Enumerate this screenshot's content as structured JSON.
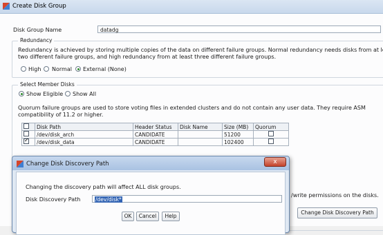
{
  "window": {
    "title": "Create Disk Group"
  },
  "disk_group": {
    "label": "Disk Group Name",
    "value": "datadg"
  },
  "redundancy": {
    "group_title": "Redundancy",
    "description_line1": "Redundancy is achieved by storing multiple copies of the data on different failure groups. Normal redundancy needs disks from at least",
    "description_line2": "two different failure groups, and high redundancy from at least three different failure groups.",
    "options": [
      "High",
      "Normal",
      "External (None)"
    ],
    "selected": "External (None)"
  },
  "member_disks": {
    "group_title": "Select Member Disks",
    "filters": [
      "Show Eligible",
      "Show All"
    ],
    "selected_filter": "Show Eligible",
    "quorum_note_line1": "Quorum failure groups are used to store voting files in extended clusters and do not contain any user data. They require ASM",
    "quorum_note_line2": "compatibility of 11.2 or higher.",
    "columns": [
      "Disk Path",
      "Header Status",
      "Disk Name",
      "Size (MB)",
      "Quorum"
    ],
    "rows": [
      {
        "path": "/dev/disk_arch",
        "status": "CANDIDATE",
        "name": "",
        "size": "51200",
        "selected": false,
        "quorum": false
      },
      {
        "path": "/dev/disk_data",
        "status": "CANDIDATE",
        "name": "",
        "size": "102400",
        "selected": true,
        "quorum": false
      }
    ],
    "permission_note": "/write permissions on the disks.",
    "change_path_button": "Change Disk Discovery Path"
  },
  "dialog": {
    "title": "Change Disk Discovery Path",
    "close_label": "x",
    "message": "Changing the discovery path will affect ALL disk groups.",
    "path_label": "Disk Discovery Path",
    "path_value": "/dev/disk*",
    "buttons": {
      "ok": "OK",
      "cancel": "Cancel",
      "help": "Help"
    }
  },
  "colors": {
    "accent": "#2f6fc0",
    "selection": "#3163b3"
  }
}
